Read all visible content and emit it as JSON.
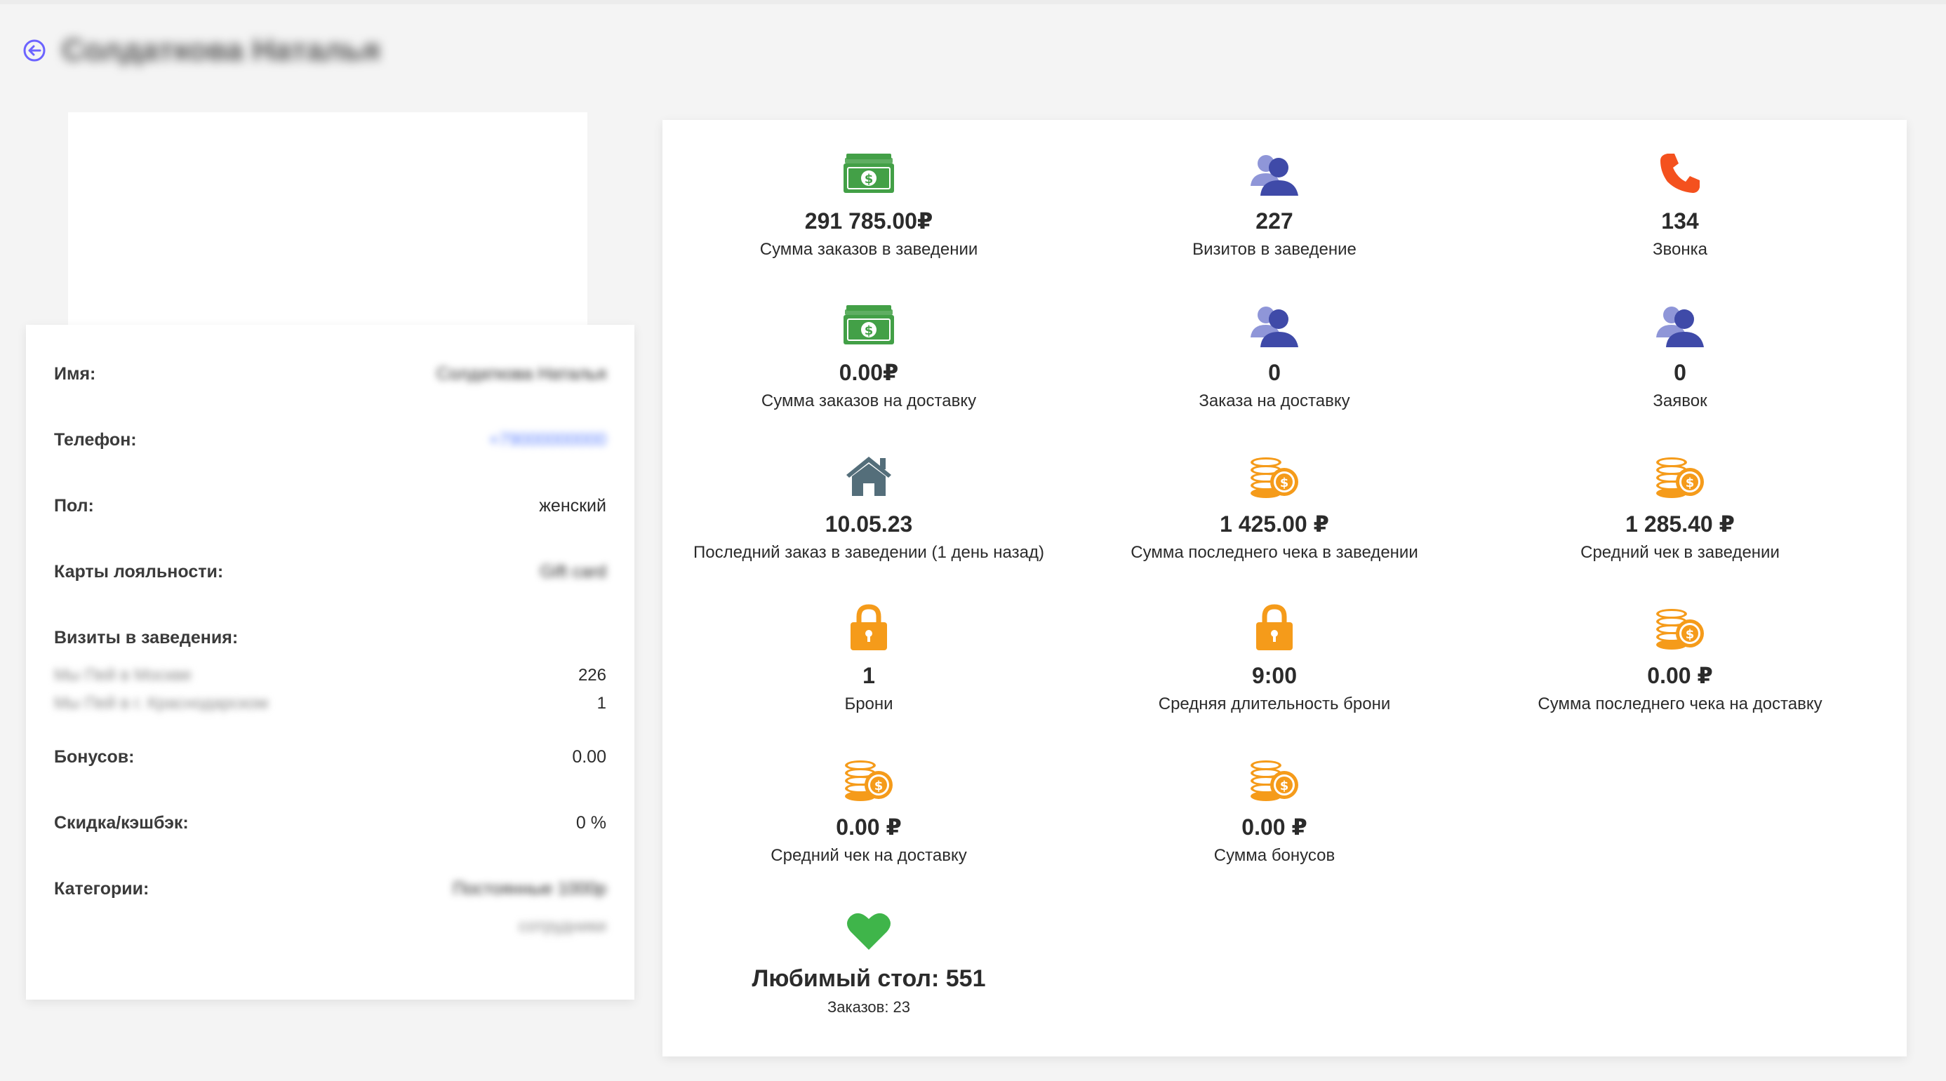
{
  "header": {
    "title": "Солдаткова Наталья"
  },
  "profile": {
    "rows": [
      {
        "key": "name",
        "label": "Имя:",
        "value": "Солдаткова Наталья"
      },
      {
        "key": "phone",
        "label": "Телефон:",
        "value": "+79000000000"
      },
      {
        "key": "gender",
        "label": "Пол:",
        "value": "женский"
      },
      {
        "key": "loyalty",
        "label": "Карты лояльности:",
        "value": "Gift card"
      },
      {
        "key": "visits",
        "label": "Визиты в заведения:",
        "value": ""
      },
      {
        "key": "bonuses",
        "label": "Бонусов:",
        "value": "0.00"
      },
      {
        "key": "discount",
        "label": "Скидка/кэшбэк:",
        "value": "0 %"
      },
      {
        "key": "categories",
        "label": "Категории:",
        "value": "Постоянные 1000р"
      }
    ],
    "visits_list": [
      {
        "name": "Мы Пей в Москве",
        "count": "226"
      },
      {
        "name": "Мы Пей в г. Краснодарском",
        "count": "1"
      }
    ],
    "categories_extra": "сотрудники"
  },
  "stats": [
    {
      "icon": "money-icon",
      "value": "291 785.00₽",
      "label": "Сумма заказов в заведении"
    },
    {
      "icon": "user-icon",
      "value": "227",
      "label": "Визитов в заведение"
    },
    {
      "icon": "phone-icon",
      "value": "134",
      "label": "Звонка"
    },
    {
      "icon": "money-icon",
      "value": "0.00₽",
      "label": "Сумма заказов на доставку"
    },
    {
      "icon": "user-icon",
      "value": "0",
      "label": "Заказа на доставку"
    },
    {
      "icon": "user-icon",
      "value": "0",
      "label": "Заявок"
    },
    {
      "icon": "house-icon",
      "value": "10.05.23",
      "label": "Последний заказ в заведении (1 день назад)"
    },
    {
      "icon": "coins-icon",
      "value": "1 425.00 ₽",
      "label": "Сумма последнего чека в заведении"
    },
    {
      "icon": "coins-icon",
      "value": "1 285.40 ₽",
      "label": "Средний чек в заведении"
    },
    {
      "icon": "lock-icon",
      "value": "1",
      "label": "Брони"
    },
    {
      "icon": "lock-icon",
      "value": "9:00",
      "label": "Средняя длительность брони"
    },
    {
      "icon": "coins-icon",
      "value": "0.00 ₽",
      "label": "Сумма последнего чека на доставку"
    },
    {
      "icon": "coins-icon",
      "value": "0.00 ₽",
      "label": "Средний чек на доставку"
    },
    {
      "icon": "coins-icon",
      "value": "0.00 ₽",
      "label": "Сумма бонусов"
    }
  ],
  "favorite": {
    "icon": "heart-icon",
    "value": "Любимый стол: 551",
    "label": "Заказов: 23"
  },
  "colors": {
    "accent": "#6c63ff",
    "money": "#43a047",
    "user_dark": "#3f4aa8",
    "user_light": "#8f96d8",
    "phone": "#f4511e",
    "house": "#546e7a",
    "lock": "#f59b1a",
    "coins": "#f59b1a",
    "heart": "#3fb54a"
  }
}
